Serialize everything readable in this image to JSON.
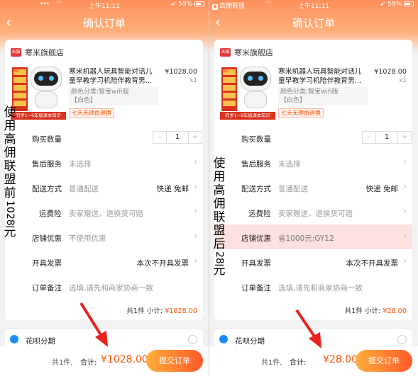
{
  "left": {
    "status": {
      "dots": "•••",
      "time": "上午11:11",
      "battery": "59%"
    },
    "header": {
      "back": "‹",
      "title": "确认订单"
    },
    "shop": {
      "badge": "天猫",
      "name": "寒米旗舰店"
    },
    "product": {
      "title": "寒米机器人玩具智能对话儿童早教学习机陪伴教育男...",
      "price": "¥1028.00",
      "qty": "x1",
      "variant": "颜色分类:智宝wifi版\n【白色】",
      "refund": "七天无理由退换",
      "image_badge": "WIFI",
      "image_banner": "同步1~6年级课本知识"
    },
    "rows": [
      {
        "label": "购买数量",
        "value": "",
        "right": ""
      },
      {
        "label": "售后服务",
        "value": "未选择",
        "right": ""
      },
      {
        "label": "配送方式",
        "value": "普通配送",
        "right": "快递 免邮"
      },
      {
        "label": "运费险",
        "value": "卖家赠送，退换货可赔",
        "right": ""
      },
      {
        "label": "店铺优惠",
        "value": "不使用优惠",
        "right": ""
      },
      {
        "label": "开具发票",
        "value": "",
        "right": "本次不开具发票"
      },
      {
        "label": "订单备注",
        "value": "选填,请先和商家协商一致",
        "right": ""
      }
    ],
    "stepper": {
      "minus": "-",
      "value": "1",
      "plus": "+"
    },
    "subtotal": {
      "prefix": "共1件  小计: ",
      "amount": "¥1028.00"
    },
    "annotation": {
      "text": "使用高佣联盟前",
      "number": "1028",
      "unit": "元"
    },
    "huabei": {
      "label": "花呗分期"
    },
    "bottom": {
      "count": "共1件,",
      "total_label": "合计:",
      "total": "¥1028.00",
      "submit": "提交订单"
    }
  },
  "right": {
    "status": {
      "carrier": "高佣联盟",
      "time": "上午11:11",
      "battery": "59%"
    },
    "header": {
      "back": "‹",
      "title": "确认订单"
    },
    "shop": {
      "badge": "天猫",
      "name": "寒米旗舰店"
    },
    "product": {
      "title": "寒米机器人玩具智能对话儿童早教学习机陪伴教育男...",
      "price": "¥1028.00",
      "qty": "x1",
      "variant": "颜色分类:智宝wifi版\n【白色】",
      "refund": "七天无理由退换",
      "image_badge": "WIFI",
      "image_banner": "同步1~6年级课本知识"
    },
    "rows": [
      {
        "label": "购买数量",
        "value": "",
        "right": ""
      },
      {
        "label": "售后服务",
        "value": "未选择",
        "right": ""
      },
      {
        "label": "配送方式",
        "value": "普通配送",
        "right": "快递 免邮"
      },
      {
        "label": "运费险",
        "value": "卖家赠送，退换货可赔",
        "right": ""
      },
      {
        "label": "店铺优惠",
        "value": "省1000元:GY12",
        "right": ""
      },
      {
        "label": "开具发票",
        "value": "",
        "right": "本次不开具发票"
      },
      {
        "label": "订单备注",
        "value": "选填,请先和商家协商一致",
        "right": ""
      }
    ],
    "stepper": {
      "minus": "-",
      "value": "1",
      "plus": "+"
    },
    "subtotal": {
      "prefix": "共1件  小计: ",
      "amount": "¥28.00"
    },
    "annotation": {
      "text": "使用高佣联盟后",
      "number": "28",
      "unit": "元"
    },
    "huabei": {
      "label": "花呗分期"
    },
    "bottom": {
      "count": "共1件,",
      "total_label": "合计:",
      "total": "¥28.00",
      "submit": "提交订单"
    }
  },
  "colors": {
    "accent": "#ff5000",
    "header": "#ff8f5a",
    "highlight_row": "#fde0e0",
    "arrow": "#e8231f"
  }
}
